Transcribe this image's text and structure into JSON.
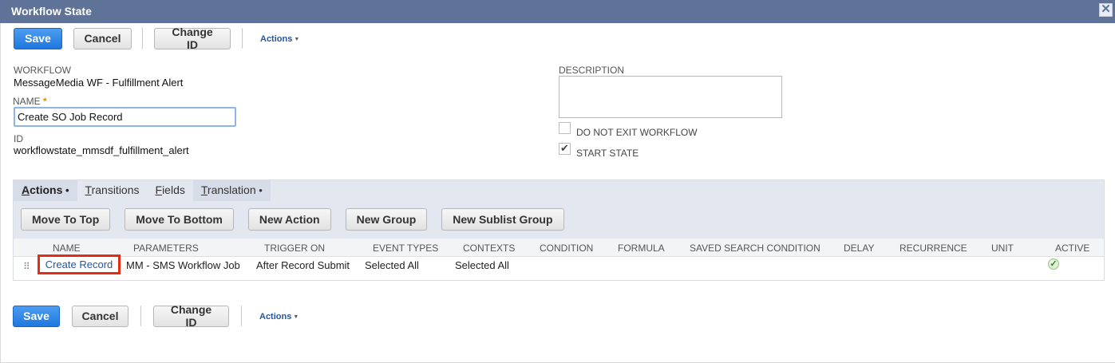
{
  "window": {
    "title": "Workflow State"
  },
  "toolbar": {
    "save": "Save",
    "cancel": "Cancel",
    "change_id": "Change ID",
    "actions": "Actions"
  },
  "form": {
    "workflow_label": "WORKFLOW",
    "workflow_value": "MessageMedia WF - Fulfillment Alert",
    "name_label": "NAME",
    "name_required": "*",
    "name_value": "Create SO Job Record",
    "id_label": "ID",
    "id_value": "workflowstate_mmsdf_fulfillment_alert",
    "description_label": "DESCRIPTION",
    "description_value": "",
    "do_not_exit_label": "DO NOT EXIT WORKFLOW",
    "do_not_exit_checked": false,
    "start_state_label": "START STATE",
    "start_state_checked": true
  },
  "sublist": {
    "tabs": [
      {
        "first": "A",
        "rest": "ctions",
        "active": true,
        "dot": true
      },
      {
        "first": "T",
        "rest": "ransitions",
        "active": false,
        "dot": false
      },
      {
        "first": "F",
        "rest": "ields",
        "active": false,
        "dot": false
      },
      {
        "first": "T",
        "rest": "ranslation",
        "active": false,
        "dot": true
      }
    ],
    "buttons": [
      "Move To Top",
      "Move To Bottom",
      "New Action",
      "New Group",
      "New Sublist Group"
    ],
    "columns": [
      "NAME",
      "PARAMETERS",
      "TRIGGER ON",
      "EVENT TYPES",
      "CONTEXTS",
      "CONDITION",
      "FORMULA",
      "SAVED SEARCH CONDITION",
      "DELAY",
      "RECURRENCE",
      "UNIT",
      "ACTIVE"
    ],
    "rows": [
      {
        "name": "Create Record",
        "parameters": "MM - SMS Workflow Job",
        "trigger_on": "After Record Submit",
        "event_types": "Selected All",
        "contexts": "Selected All",
        "condition": "",
        "formula": "",
        "saved_search_condition": "",
        "delay": "",
        "recurrence": "",
        "unit": "",
        "active": true
      }
    ]
  },
  "icons": {
    "close": "close-icon",
    "active": "checkmark-icon",
    "drag": "drag-handle-icon"
  }
}
